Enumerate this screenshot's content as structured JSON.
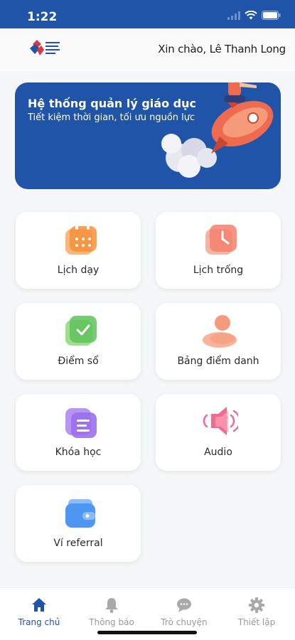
{
  "status_bar": {
    "time": "1:22"
  },
  "header": {
    "greeting": "Xin chào, Lê Thanh Long"
  },
  "banner": {
    "title": "Hệ thống quản lý giáo dục",
    "subtitle": "Tiết kiệm thời gian, tối ưu nguồn lực"
  },
  "menu": {
    "items": [
      {
        "label": "Lịch dạy",
        "icon": "calendar-icon",
        "color": "#f7923a"
      },
      {
        "label": "Lịch trống",
        "icon": "clock-icon",
        "color": "#f4816e"
      },
      {
        "label": "Điểm sổ",
        "icon": "checkmark-icon",
        "color": "#5fc25c"
      },
      {
        "label": "Bảng điểm danh",
        "icon": "attendance-icon",
        "color": "#f59a7c"
      },
      {
        "label": "Khóa học",
        "icon": "course-icon",
        "color": "#9a6ff0"
      },
      {
        "label": "Audio",
        "icon": "speaker-icon",
        "color": "#f36a8e"
      },
      {
        "label": "Ví referral",
        "icon": "wallet-icon",
        "color": "#4d97f2"
      }
    ]
  },
  "bottom_nav": {
    "items": [
      {
        "label": "Trang chủ",
        "icon": "home-icon",
        "active": true
      },
      {
        "label": "Thông báo",
        "icon": "bell-icon",
        "active": false
      },
      {
        "label": "Trò chuyện",
        "icon": "chat-icon",
        "active": false
      },
      {
        "label": "Thiết lập",
        "icon": "gear-icon",
        "active": false
      }
    ]
  },
  "colors": {
    "brand": "#1f54a8",
    "active_nav": "#1f54a8",
    "inactive_nav": "#9a9a9a"
  }
}
